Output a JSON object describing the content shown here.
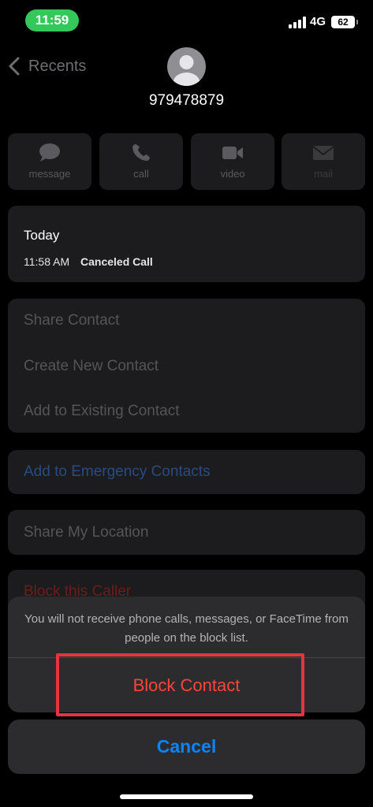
{
  "status_bar": {
    "time": "11:59",
    "network": "4G",
    "battery": "62"
  },
  "header": {
    "back_label": "Recents",
    "phone_number": "979478879"
  },
  "actions": [
    {
      "label": "message",
      "icon": "message-icon"
    },
    {
      "label": "call",
      "icon": "phone-icon"
    },
    {
      "label": "video",
      "icon": "video-icon"
    },
    {
      "label": "mail",
      "icon": "mail-icon"
    }
  ],
  "recent_calls": {
    "day": "Today",
    "time": "11:58 AM",
    "status": "Canceled Call"
  },
  "options": [
    "Share Contact",
    "Create New Contact",
    "Add to Existing Contact"
  ],
  "emergency": "Add to Emergency Contacts",
  "share_location": "Share My Location",
  "block_caller": "Block this Caller",
  "action_sheet": {
    "message": "You will not receive phone calls, messages, or FaceTime from people on the block list.",
    "block_label": "Block Contact",
    "cancel_label": "Cancel"
  },
  "colors": {
    "status_green": "#34c759",
    "destructive": "#ff453a",
    "accent_blue": "#0a84ff",
    "highlight": "#e53341"
  }
}
